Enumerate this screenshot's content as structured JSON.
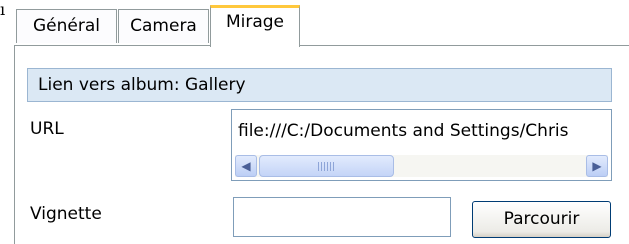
{
  "tabs": [
    {
      "label": "Général",
      "active": false
    },
    {
      "label": "Camera",
      "active": false
    },
    {
      "label": "Mirage",
      "active": true
    }
  ],
  "album_link": {
    "text": "Lien vers album: Gallery"
  },
  "fields": {
    "url": {
      "label": "URL",
      "value": "file:///C:/Documents and Settings/Chris"
    },
    "vignette": {
      "label": "Vignette",
      "value": ""
    }
  },
  "buttons": {
    "browse": "Parcourir"
  },
  "scrollbar": {
    "left_arrow": "◀",
    "right_arrow": "▶"
  },
  "colors": {
    "active_tab_accent": "#ffc83c",
    "header_bar_bg": "#dbe8f4",
    "field_border": "#7f9db9"
  }
}
